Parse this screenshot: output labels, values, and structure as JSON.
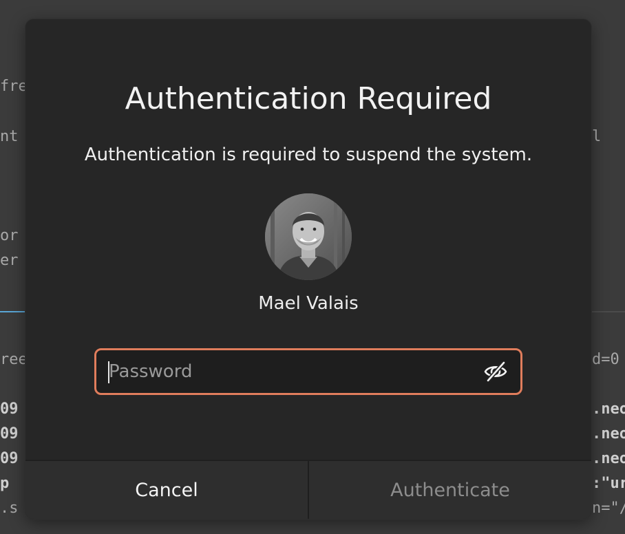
{
  "background": {
    "left_fragments": [
      "fre",
      "nt",
      "or",
      "er",
      "ree",
      "09",
      "09",
      "09",
      "p",
      ".s"
    ],
    "right_fragments": [
      "l",
      "d=0",
      ".neo",
      ".neo",
      ".neo",
      ":\"ur",
      "n=\"/"
    ]
  },
  "dialog": {
    "title": "Authentication Required",
    "message": "Authentication is required to suspend the system.",
    "user": {
      "name": "Mael Valais",
      "avatar_icon": "user-avatar-photo"
    },
    "password": {
      "value": "",
      "placeholder": "Password",
      "reveal_icon": "eye-slash-icon"
    },
    "buttons": {
      "cancel_label": "Cancel",
      "authenticate_label": "Authenticate"
    },
    "colors": {
      "focus_ring": "#e07d5c",
      "background": "#262626"
    }
  }
}
